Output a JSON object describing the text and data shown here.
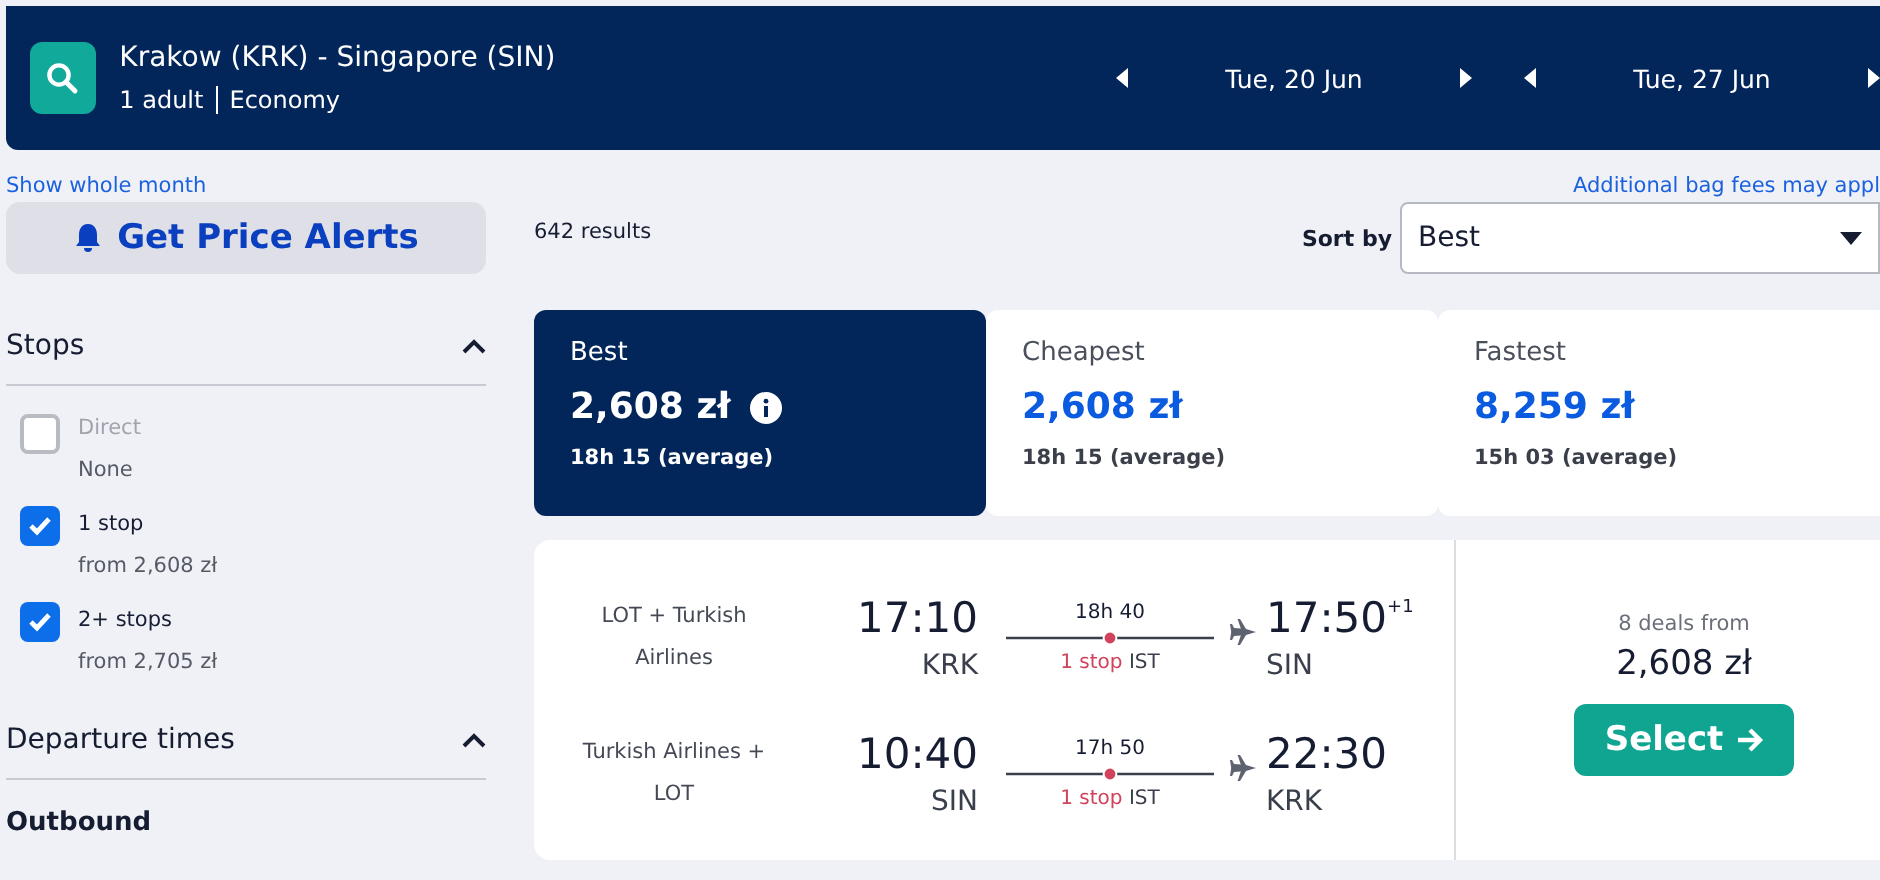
{
  "header": {
    "route": "Krakow (KRK) - Singapore (SIN)",
    "passengers": "1 adult",
    "cabin": "Economy",
    "dates": [
      {
        "label": "Tue, 20 Jun"
      },
      {
        "label": "Tue, 27 Jun"
      }
    ]
  },
  "links": {
    "show_month": "Show whole month",
    "bag_fees": "Additional bag fees may appl"
  },
  "alerts_button": "Get Price Alerts",
  "filters": [
    {
      "title": "Stops",
      "expanded": true,
      "options": [
        {
          "label": "Direct",
          "sublabel": "None",
          "checked": false,
          "disabled": true
        },
        {
          "label": "1 stop",
          "sublabel": "from 2,608 zł",
          "checked": true,
          "disabled": false
        },
        {
          "label": "2+ stops",
          "sublabel": "from 2,705 zł",
          "checked": true,
          "disabled": false
        }
      ]
    },
    {
      "title": "Departure times",
      "expanded": true,
      "subheading": "Outbound"
    }
  ],
  "results_count": "642 results",
  "sort": {
    "label": "Sort by",
    "value": "Best"
  },
  "sort_tabs": [
    {
      "label": "Best",
      "price": "2,608 zł",
      "duration": "18h 15 (average)",
      "selected": true
    },
    {
      "label": "Cheapest",
      "price": "2,608 zł",
      "duration": "18h 15 (average)",
      "selected": false
    },
    {
      "label": "Fastest",
      "price": "8,259 zł",
      "duration": "15h 03 (average)",
      "selected": false
    }
  ],
  "result": {
    "legs": [
      {
        "airline": "LOT + Turkish Airlines",
        "depart": "17:10",
        "from": "KRK",
        "duration": "18h 40",
        "stops": "1 stop",
        "via": "IST",
        "arrive": "17:50",
        "day_offset": "+1",
        "to": "SIN"
      },
      {
        "airline": "Turkish Airlines + LOT",
        "depart": "10:40",
        "from": "SIN",
        "duration": "17h 50",
        "stops": "1 stop",
        "via": "IST",
        "arrive": "22:30",
        "to": "KRK"
      }
    ],
    "deals": "8 deals from",
    "price": "2,608 zł",
    "button": "Select"
  }
}
